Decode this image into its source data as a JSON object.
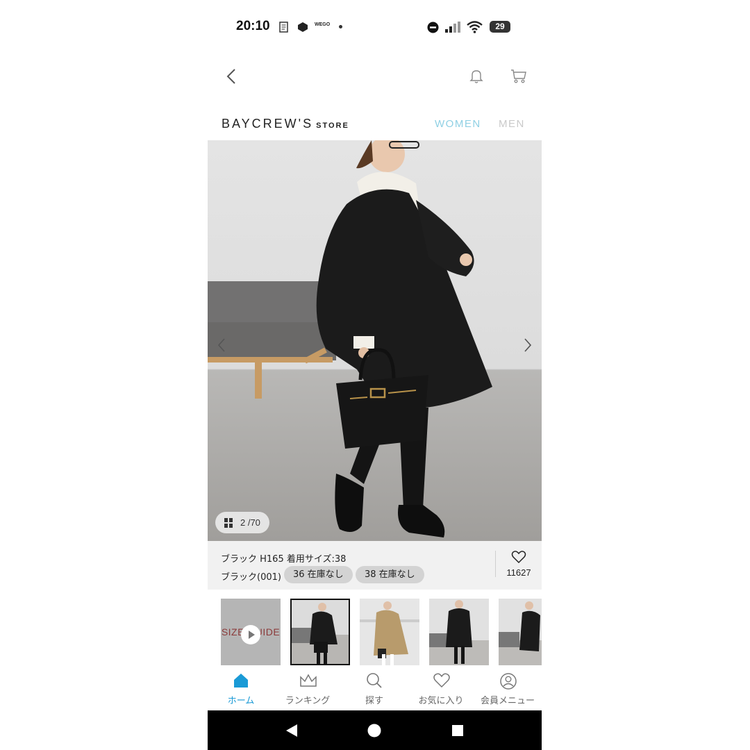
{
  "status_bar": {
    "time": "20:10",
    "battery": "29",
    "app_badge": "WEGO"
  },
  "header": {
    "back_icon": "chevron-left-icon",
    "notification_icon": "bell-icon",
    "cart_icon": "cart-icon"
  },
  "brand": {
    "name": "BAYCREW'S",
    "suffix": "STORE"
  },
  "gender_tabs": {
    "women": "WOMEN",
    "men": "MEN",
    "active_color": "#8fd0e4"
  },
  "gallery": {
    "counter": "2 /70"
  },
  "product_info": {
    "size_info": "ブラック H165 着用サイズ:38",
    "color_label": "ブラック(001)",
    "stock_pills": [
      "36 在庫なし",
      "38 在庫なし"
    ],
    "likes": "11627"
  },
  "thumbnails": {
    "size_guide_text": "SIZE GUIDE"
  },
  "bottom_nav": [
    {
      "label": "ホーム",
      "icon": "home-icon"
    },
    {
      "label": "ランキング",
      "icon": "crown-icon"
    },
    {
      "label": "探す",
      "icon": "search-icon"
    },
    {
      "label": "お気に入り",
      "icon": "heart-icon"
    },
    {
      "label": "会員メニュー",
      "icon": "user-icon"
    }
  ],
  "colors": {
    "accent": "#1a9ad6"
  }
}
